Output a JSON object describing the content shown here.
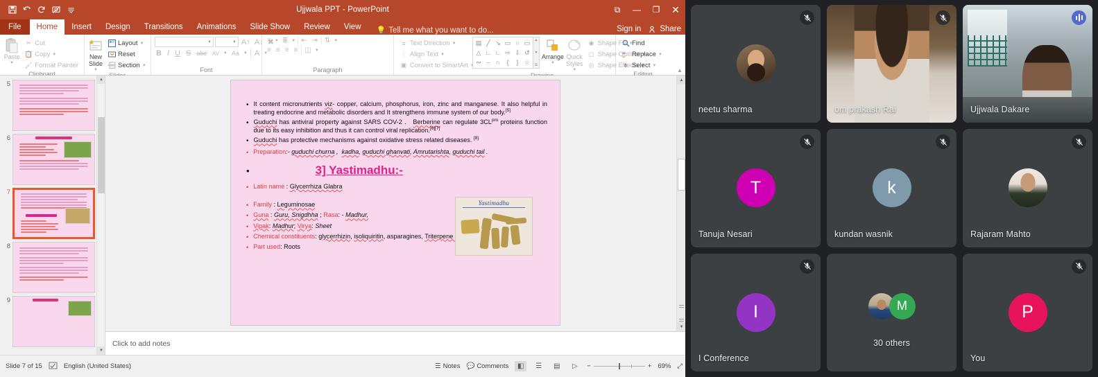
{
  "powerpoint": {
    "title": "Ujjwala PPT - PowerPoint",
    "quick_access": [
      {
        "name": "save",
        "glyph": "⬚"
      },
      {
        "name": "undo",
        "glyph": "↶"
      },
      {
        "name": "redo",
        "glyph": "↻"
      },
      {
        "name": "start-slideshow",
        "glyph": "▷"
      },
      {
        "name": "customize-quick-access-toolbar",
        "glyph": "≡"
      }
    ],
    "window_buttons": {
      "ribbon_display_options": "⧉",
      "minimize": "—",
      "restore": "❐",
      "close": "✕"
    },
    "tabs": [
      {
        "label": "File",
        "active": false
      },
      {
        "label": "Home",
        "active": true
      },
      {
        "label": "Insert",
        "active": false
      },
      {
        "label": "Design",
        "active": false
      },
      {
        "label": "Transitions",
        "active": false
      },
      {
        "label": "Animations",
        "active": false
      },
      {
        "label": "Slide Show",
        "active": false
      },
      {
        "label": "Review",
        "active": false
      },
      {
        "label": "View",
        "active": false
      }
    ],
    "tell_me": "Tell me what you want to do...",
    "sign_in": "Sign in",
    "share": "Share",
    "ribbon": {
      "clipboard": {
        "label": "Clipboard",
        "paste": "Paste",
        "items": [
          {
            "label": "Cut",
            "icon": "scissors-icon"
          },
          {
            "label": "Copy",
            "icon": "copy-icon"
          },
          {
            "label": "Format Painter",
            "icon": "format-painter-icon"
          }
        ]
      },
      "slides": {
        "label": "Slides",
        "new_slide": "New Slide",
        "items": [
          {
            "label": "Layout",
            "icon": "layout-icon"
          },
          {
            "label": "Reset",
            "icon": "reset-icon"
          },
          {
            "label": "Section",
            "icon": "section-icon"
          }
        ]
      },
      "font": {
        "label": "Font",
        "font_name_value": "",
        "font_size_value": "",
        "buttons": [
          "B",
          "I",
          "U",
          "S",
          "abc",
          "AV",
          "Aa",
          "A"
        ]
      },
      "paragraph": {
        "label": "Paragraph",
        "items": [
          {
            "label": "Text Direction",
            "icon": "text-direction-icon"
          },
          {
            "label": "Align Text",
            "icon": "align-text-icon"
          },
          {
            "label": "Convert to SmartArt",
            "icon": "smartart-icon"
          }
        ]
      },
      "drawing": {
        "label": "Drawing",
        "arrange": "Arrange",
        "quick_styles": "Quick Styles",
        "shapes": [
          "▤",
          "╲",
          "↘",
          "▭",
          "○",
          "▭",
          "△",
          "┘",
          "┘",
          "⇨",
          "⇩",
          "⟳",
          "≋",
          "⌒",
          "∩",
          "{",
          "}",
          "☆"
        ],
        "items": [
          {
            "label": "Shape Fill",
            "icon": "shape-fill-icon"
          },
          {
            "label": "Shape Outline",
            "icon": "shape-outline-icon"
          },
          {
            "label": "Shape Effects",
            "icon": "shape-effects-icon"
          }
        ]
      },
      "editing": {
        "label": "Editing",
        "items": [
          {
            "label": "Find",
            "icon": "search-icon"
          },
          {
            "label": "Replace",
            "icon": "replace-icon"
          },
          {
            "label": "Select",
            "icon": "select-icon"
          }
        ]
      }
    },
    "thumbnails": [
      {
        "number": "5",
        "selected": false,
        "has_image": false
      },
      {
        "number": "6",
        "selected": false,
        "has_image": true,
        "title": "2] Guduchi:"
      },
      {
        "number": "7",
        "selected": true,
        "has_image": true,
        "title": "3] Yastimadhu:"
      },
      {
        "number": "8",
        "selected": false,
        "has_image": false
      },
      {
        "number": "9",
        "selected": false,
        "has_image": true,
        "title": "4] Tulsi:"
      }
    ],
    "slide": {
      "bullets": [
        {
          "color": "black",
          "html": "It content micronutrients <span class=\"u\">viz</span>- copper, calcium, phosphorus, iron, zinc and manganese. It also helpful in treating endocrine and metabolic disorders and It strengthens immune system of our body.<sup>[5]</sup>"
        },
        {
          "color": "black",
          "html": "<span class=\"u\">Guduchi</span> has antiviral property against SARS COV-2 . &nbsp; <span class=\"u\">Berberine</span> can regulate 3CL<sup>pro</sup> proteins function due to its easy inhibition and thus it can control viral replication.<sup>[6][7]</sup>"
        },
        {
          "color": "black",
          "html": "<span class=\"u\">Guduchi</span> has protective mechanisms against oxidative stress related diseases. <sup>[8]</sup>"
        },
        {
          "color": "red",
          "html": "<span class=\"lbl\">Preparation</span><i>:- <span class=\"u\">guduchi churna</span> , &nbsp;<span class=\"u\">kadha</span>, <span class=\"u\">guduchi ghanvati</span>, <span class=\"u\">Amrutarishta</span>, <span class=\"u\">guduchi tail</span> .</i>"
        }
      ],
      "heading": "3] Yastimadhu:-",
      "lower_bullets": [
        {
          "html": "<span class=\"lbl\">Latin name</span> : <span class=\"u\">Glycerrhiza Glabra</span>"
        },
        {
          "html": "<span class=\"lbl\">Family</span> : <span class=\"u\">Leguminosae</span>"
        },
        {
          "html": "<span class=\"lbl u\">Guna</span> : <i><span class=\"u\">Guru, Snigdhha</span></i> ; <span class=\"lbl\">Rasa</span>: - <i><span class=\"u\">Madhur,</span></i>"
        },
        {
          "html": "<span class=\"lbl u\">Vipak</span>: <i><span class=\"u\">Madhur</span></i>; <span class=\"lbl u\">Virya</span>: <i>Sheet</i>"
        },
        {
          "html": "<span class=\"lbl\">Chemical constituents</span>: <span class=\"u\">glycerrhizin</span>, <span class=\"u\">isoliquiritin</span>, asparagines, <span class=\"u\">Triterpene saponin</span>, <span class=\"u\">Glycerrhizic</span> acid."
        },
        {
          "html": "<span class=\"lbl\">Part used</span>: Roots"
        }
      ],
      "photo_caption": "Yastimadhu"
    },
    "notes_placeholder": "Click to add notes",
    "status_bar": {
      "slide_counter": "Slide 7 of 15",
      "language": "English (United States)",
      "notes": "Notes",
      "comments": "Comments",
      "views": [
        {
          "name": "normal-view",
          "glyph": "◧",
          "active": true
        },
        {
          "name": "slide-sorter-view",
          "glyph": "☰",
          "active": false
        },
        {
          "name": "reading-view",
          "glyph": "▤",
          "active": false
        },
        {
          "name": "slide-show-view",
          "glyph": "▷",
          "active": false
        }
      ],
      "zoom_out": "−",
      "zoom_in": "+",
      "zoom_level": "69%",
      "fit_to_window": "⤢"
    }
  },
  "meet": {
    "accent_speaking": "#8ab4f8",
    "tiles": [
      {
        "name": "neetu sharma",
        "type": "photo-avatar",
        "muted": true,
        "speaking": false,
        "avatar_kind": "ph-neetu",
        "name_align": "left"
      },
      {
        "name": "om prakash Rai",
        "type": "video",
        "muted": true,
        "speaking": false,
        "video_kind": "ph-om",
        "name_align": "left"
      },
      {
        "name": "Ujjwala Dakare",
        "type": "video",
        "muted": false,
        "speaking": true,
        "video_kind": "ph-ujjwala",
        "name_align": "left"
      },
      {
        "name": "Tanuja Nesari",
        "type": "initial",
        "initial": "T",
        "color": "#cf00b4",
        "muted": true,
        "speaking": false,
        "name_align": "left"
      },
      {
        "name": "kundan wasnik",
        "type": "initial",
        "initial": "k",
        "color": "#7f9bab",
        "muted": true,
        "speaking": false,
        "name_align": "left"
      },
      {
        "name": "Rajaram Mahto",
        "type": "photo-avatar",
        "muted": true,
        "speaking": false,
        "avatar_kind": "ph-rajaram",
        "name_align": "left"
      },
      {
        "name": "I Conference",
        "type": "initial",
        "initial": "I",
        "color": "#9334c4",
        "muted": true,
        "speaking": false,
        "name_align": "left"
      },
      {
        "name": "30 others",
        "type": "others",
        "others_initial": "M",
        "others_color": "#34a853",
        "muted": false,
        "speaking": false,
        "name_align": "center"
      },
      {
        "name": "You",
        "type": "initial",
        "initial": "P",
        "color": "#e8145b",
        "muted": true,
        "speaking": false,
        "name_align": "left"
      }
    ]
  }
}
